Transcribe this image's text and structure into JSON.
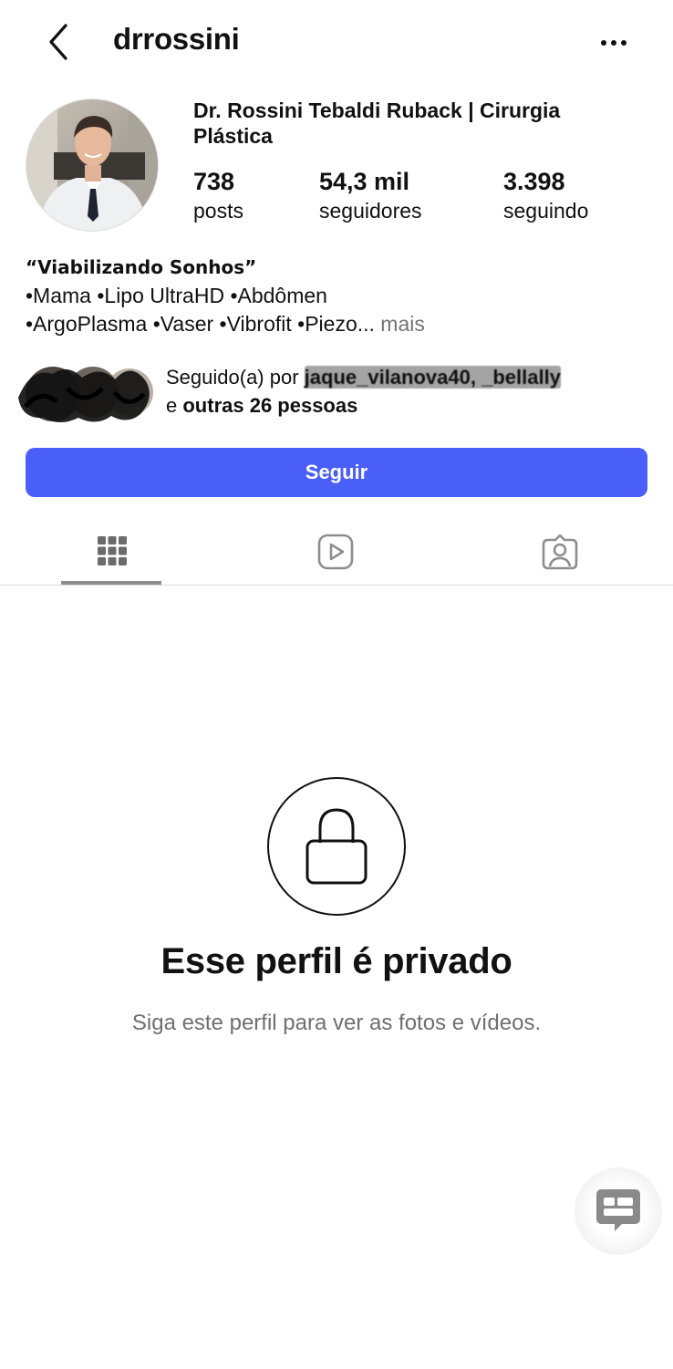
{
  "header": {
    "username": "drrossini"
  },
  "profile": {
    "full_name": "Dr. Rossini Tebaldi Ruback | Cirurgia Plástica",
    "stats": {
      "posts_count": "738",
      "posts_label": "posts",
      "followers_count": "54,3 mil",
      "followers_label": "seguidores",
      "following_count": "3.398",
      "following_label": "seguindo"
    },
    "bio": {
      "title": "“Viabilizando Sonhos”",
      "line1": "•Mama •Lipo UltraHD •Abdômen",
      "line2": "•ArgoPlasma •Vaser •Vibrofit •Piezo...",
      "more": "mais"
    },
    "followed_by": {
      "prefix": "Seguido(a) por ",
      "names": "jaque_vilanova40, _bellally",
      "connector": "e ",
      "others": "outras 26 pessoas"
    },
    "follow_button": "Seguir"
  },
  "tabs": [
    {
      "name": "grid",
      "icon": "grid-icon",
      "active": true
    },
    {
      "name": "reels",
      "icon": "reels-icon",
      "active": false
    },
    {
      "name": "tagged",
      "icon": "tagged-icon",
      "active": false
    }
  ],
  "private": {
    "title": "Esse perfil é privado",
    "subtitle": "Siga este perfil para ver as fotos e vídeos."
  },
  "floating": {
    "icon": "chat-icon"
  },
  "colors": {
    "accent": "#4a5ff7",
    "secondary_text": "#737373"
  }
}
